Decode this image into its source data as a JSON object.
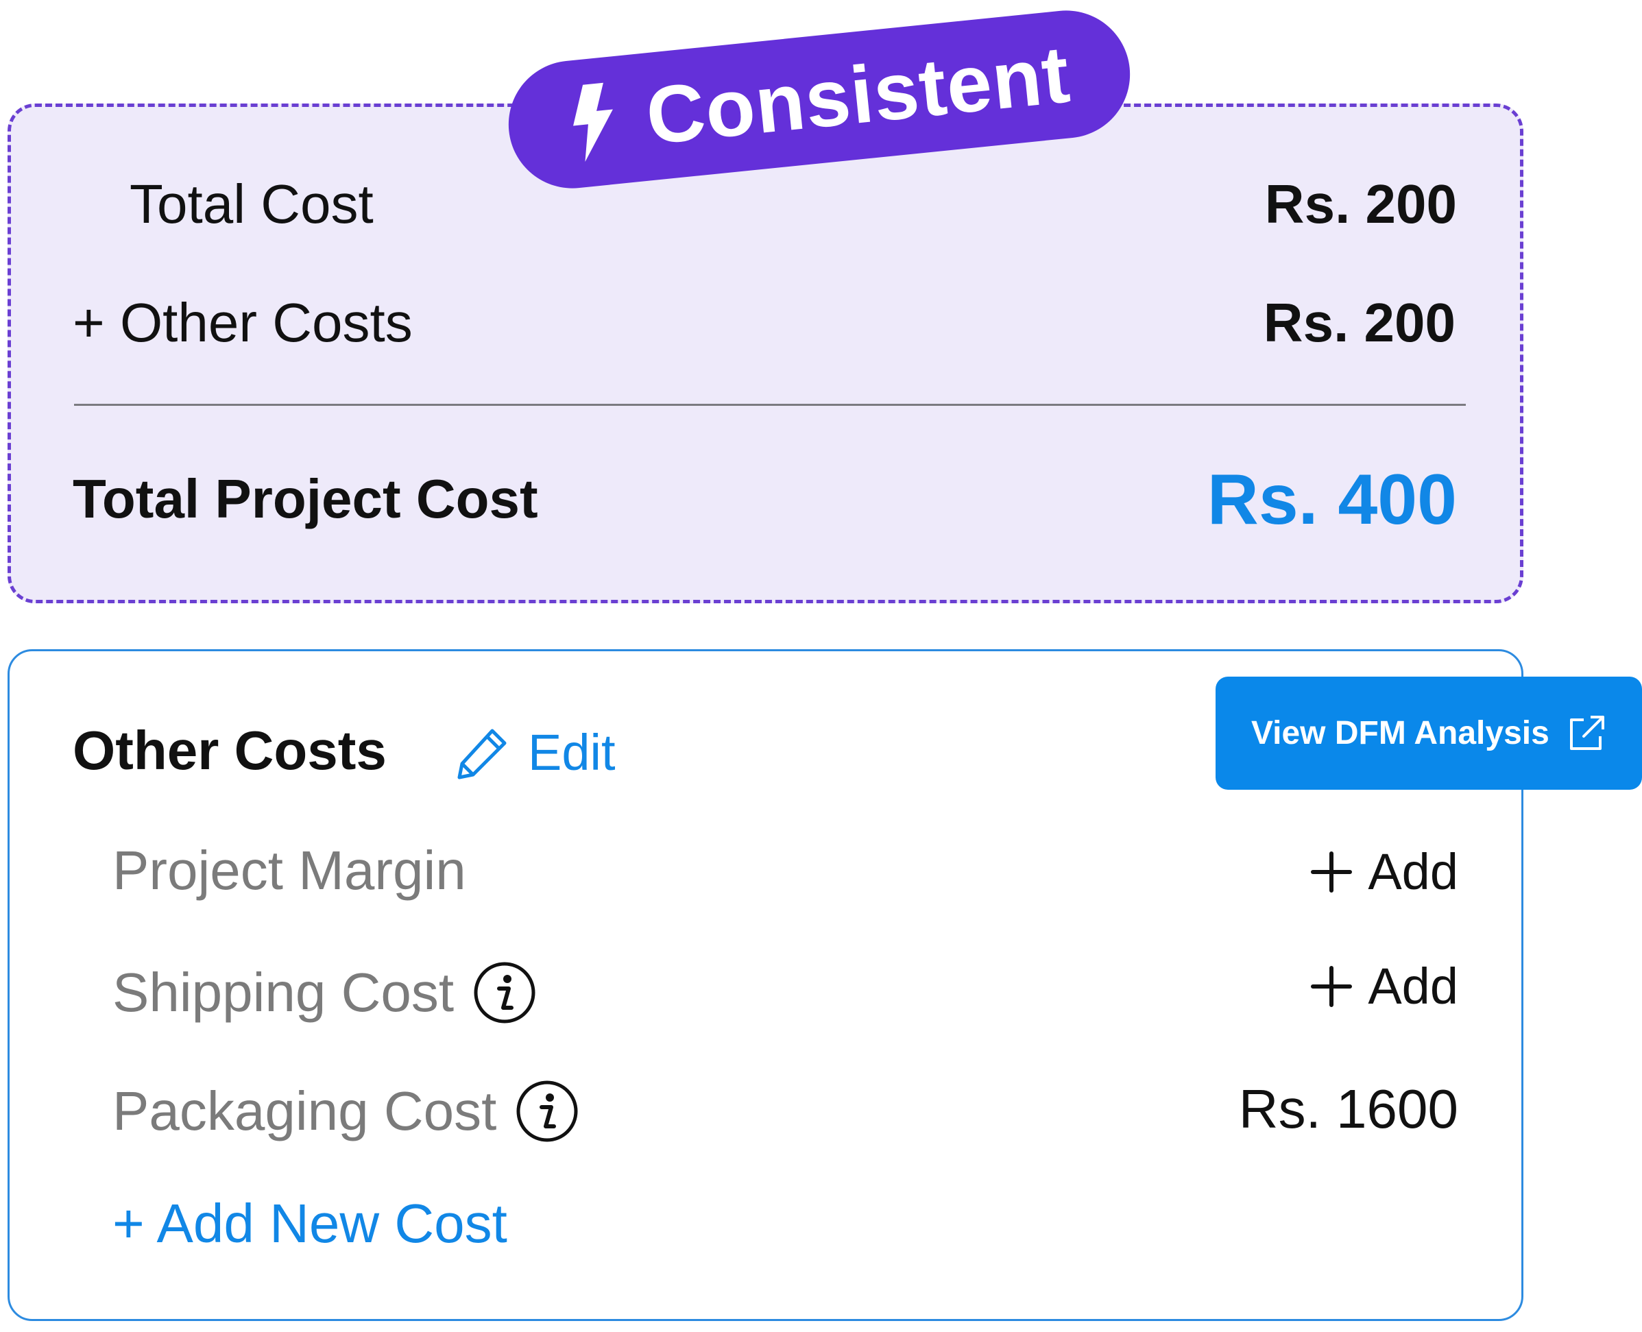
{
  "badge": {
    "label": "Consistent",
    "icon": "lightning-bolt-icon",
    "color": "#6430d9"
  },
  "summary": {
    "total_cost_label": "Total Cost",
    "total_cost_value": "Rs. 200",
    "other_costs_label": "+ Other Costs",
    "other_costs_value": "Rs. 200",
    "project_cost_label": "Total Project Cost",
    "project_cost_value": "Rs. 400",
    "background": "#eeeafa",
    "border_color": "#6a3fd2",
    "accent_color": "#1187e6"
  },
  "other_costs": {
    "title": "Other Costs",
    "edit_label": "Edit",
    "edit_icon": "pencil-icon",
    "items": [
      {
        "label": "Project Margin",
        "action": "Add",
        "action_icon": "plus-icon"
      },
      {
        "label": "Shipping Cost",
        "info_icon": "info-icon",
        "action": "Add",
        "action_icon": "plus-icon"
      },
      {
        "label": "Packaging Cost",
        "info_icon": "info-icon",
        "value": "Rs. 1600"
      }
    ],
    "add_new_label": "+ Add New Cost"
  },
  "dfm_button": {
    "label": "View DFM Analysis",
    "icon": "external-link-icon",
    "color": "#0a88ea"
  }
}
